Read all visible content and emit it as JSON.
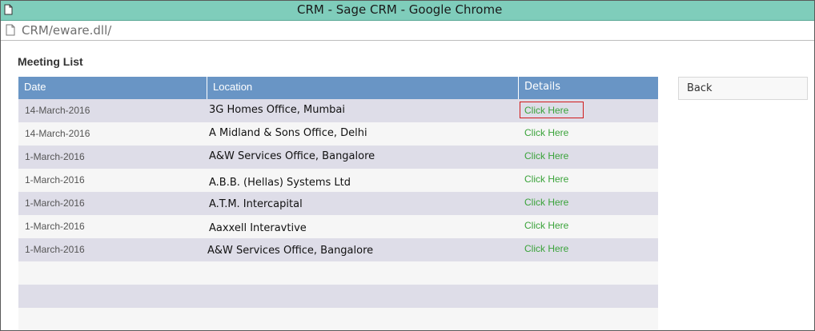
{
  "window": {
    "title": "CRM - Sage CRM - Google Chrome",
    "url": "CRM/eware.dll/"
  },
  "page": {
    "title": "Meeting List",
    "back_label": "Back"
  },
  "table": {
    "columns": [
      "Date",
      "Location",
      "Details"
    ],
    "rows": [
      {
        "date": "14-March-2016",
        "location": "3G Homes Office, Mumbai",
        "details": "Click Here"
      },
      {
        "date": "14-March-2016",
        "location": "A Midland & Sons Office, Delhi",
        "details": "Click Here"
      },
      {
        "date": "1-March-2016",
        "location": "A&W Services Office, Bangalore",
        "details": "Click Here"
      },
      {
        "date": "1-March-2016",
        "location": "A.B.B. (Hellas) Systems Ltd",
        "details": "Click Here"
      },
      {
        "date": "1-March-2016",
        "location": "A.T.M. Intercapital",
        "details": "Click Here"
      },
      {
        "date": "1-March-2016",
        "location": "Aaxxell Interavtive",
        "details": "Click Here"
      },
      {
        "date": "1-March-2016",
        "location": "A&W Services Office, Bangalore",
        "details": "Click Here"
      }
    ],
    "selected_row": 0
  },
  "colors": {
    "header": "#6995c5",
    "row_odd": "#dedde8",
    "row_even": "#f6f6f6",
    "link": "#3aa33a",
    "selection_border": "#d11a1a",
    "titlebar": "#7fcdbb"
  },
  "icons": {
    "window": "page-icon",
    "address": "page-icon"
  }
}
